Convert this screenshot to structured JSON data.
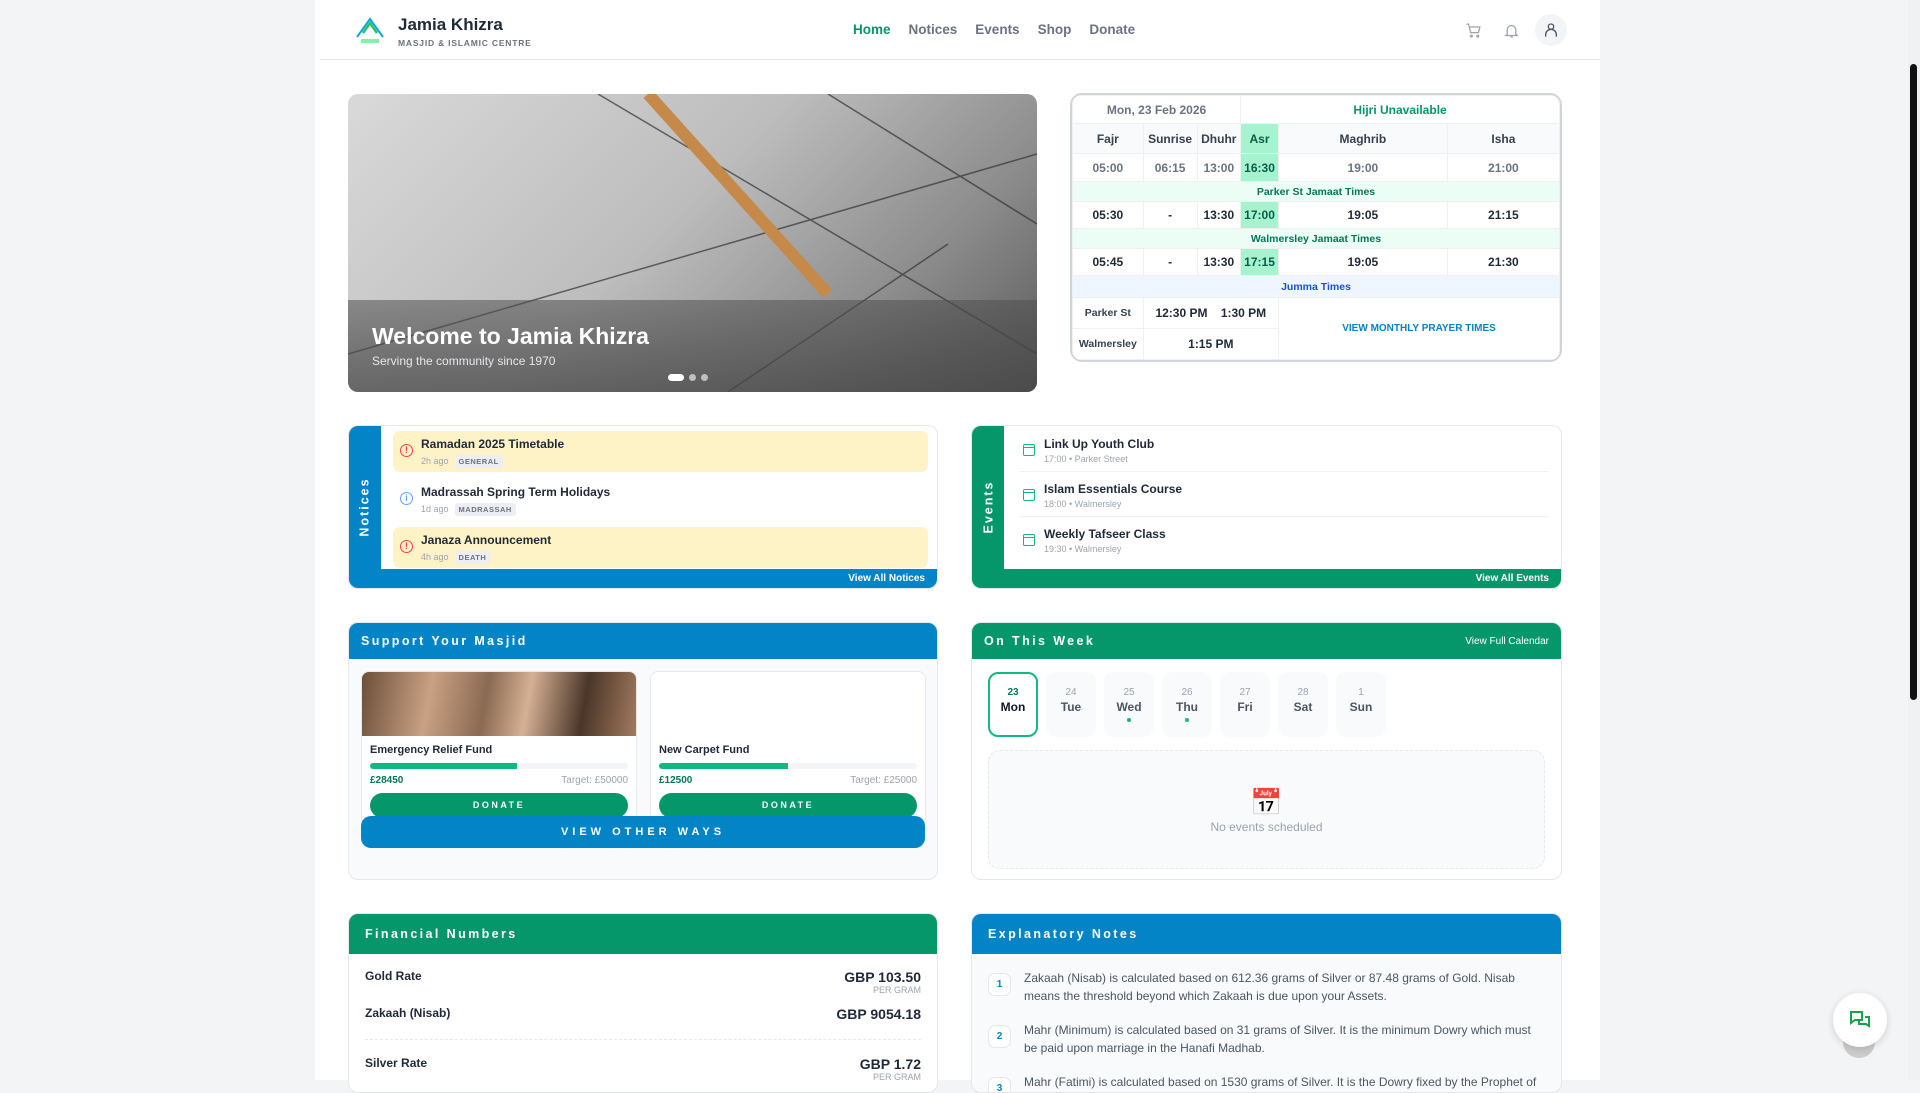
{
  "header": {
    "title": "Jamia Khizra",
    "subtitle": "MASJID & ISLAMIC CENTRE",
    "nav": [
      "Home",
      "Notices",
      "Events",
      "Shop",
      "Donate"
    ],
    "active": "Home"
  },
  "hero": {
    "title": "Welcome to Jamia Khizra",
    "subtitle": "Serving the community since 1970",
    "slides": 3,
    "active_slide": 1
  },
  "prayer": {
    "date": "Mon, 23 Feb 2026",
    "hijri": "Hijri Unavailable",
    "names": [
      "Fajr",
      "Sunrise",
      "Dhuhr",
      "Asr",
      "Maghrib",
      "Isha"
    ],
    "start": [
      "05:00",
      "06:15",
      "13:00",
      "16:30",
      "19:00",
      "21:00"
    ],
    "parker_label": "Parker St Jamaat Times",
    "parker": [
      "05:30",
      "-",
      "13:30",
      "17:00",
      "19:05",
      "21:15"
    ],
    "walm_label": "Walmersley Jamaat Times",
    "walm": [
      "05:45",
      "-",
      "13:30",
      "17:15",
      "19:05",
      "21:30"
    ],
    "jumma_label": "Jumma Times",
    "jumma": [
      {
        "place": "Parker St",
        "t1": "12:30 PM",
        "t2": "1:30 PM"
      },
      {
        "place": "Walmersley",
        "t1": "1:15 PM"
      }
    ],
    "monthly_link": "VIEW MONTHLY PRAYER TIMES"
  },
  "notices": {
    "label": "Notices",
    "view_all": "View All Notices",
    "items": [
      {
        "title": "Ramadan 2025 Timetable",
        "ago": "2h ago",
        "tag": "GENERAL"
      },
      {
        "title": "Madrassah Spring Term Holidays",
        "ago": "1d ago",
        "tag": "MADRASSAH"
      },
      {
        "title": "Janaza Announcement",
        "ago": "4h ago",
        "tag": "DEATH"
      }
    ]
  },
  "events": {
    "label": "Events",
    "view_all": "View All Events",
    "items": [
      {
        "title": "Link Up Youth Club",
        "meta": "17:00 • Parker Street"
      },
      {
        "title": "Islam Essentials Course",
        "meta": "18:00 • Walmersley"
      },
      {
        "title": "Weekly Tafseer Class",
        "meta": "19:30 • Walmersley"
      }
    ]
  },
  "support": {
    "title": "Support Your Masjid",
    "funds": [
      {
        "name": "Emergency Relief Fund",
        "raised": "£28450",
        "target": "Target: £50000",
        "progress": 0.569,
        "button": "DONATE"
      },
      {
        "name": "New Carpet Fund",
        "raised": "£12500",
        "target": "Target: £25000",
        "progress": 0.5,
        "button": "DONATE"
      }
    ],
    "other": "VIEW OTHER WAYS"
  },
  "week": {
    "title": "On This Week",
    "link": "View Full Calendar",
    "days": [
      {
        "n": "23",
        "w": "Mon",
        "sel": true
      },
      {
        "n": "24",
        "w": "Tue"
      },
      {
        "n": "25",
        "w": "Wed",
        "dot": true
      },
      {
        "n": "26",
        "w": "Thu",
        "dot": true
      },
      {
        "n": "27",
        "w": "Fri"
      },
      {
        "n": "28",
        "w": "Sat"
      },
      {
        "n": "1",
        "w": "Sun"
      }
    ],
    "empty": "No events scheduled",
    "empty_icon": "📅"
  },
  "financial": {
    "title": "Financial Numbers",
    "rows": [
      {
        "label": "Gold Rate",
        "value": "GBP 103.50",
        "unit": "PER GRAM"
      },
      {
        "label": "Zakaah (Nisab)",
        "value": "GBP 9054.18"
      },
      {
        "label": "Silver Rate",
        "value": "GBP 1.72",
        "unit": "PER GRAM"
      }
    ]
  },
  "notes": {
    "title": "Explanatory Notes",
    "items": [
      {
        "n": "1",
        "text": "Zakaah (Nisab) is calculated based on 612.36 grams of Silver or 87.48 grams of Gold. Nisab means the threshold beyond which Zakaah is due upon your Assets."
      },
      {
        "n": "2",
        "text": "Mahr (Minimum) is calculated based on 31 grams of Silver. It is the minimum Dowry which must be paid upon marriage in the Hanafi Madhab."
      },
      {
        "n": "3",
        "text": "Mahr (Fatimi) is calculated based on 1530 grams of Silver. It is the Dowry fixed by the Prophet of"
      }
    ]
  },
  "colors": {
    "green": "#059669",
    "blue": "#0284c7"
  }
}
